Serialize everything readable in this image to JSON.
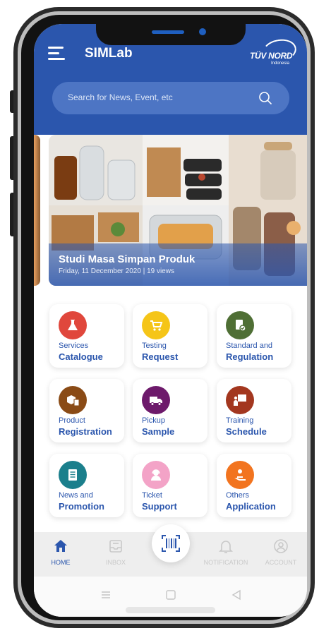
{
  "header": {
    "app_title": "SIMLab",
    "brand": {
      "name": "TÜV NORD",
      "sub": "Indonesia"
    }
  },
  "search": {
    "placeholder": "Search for News, Event, etc"
  },
  "banner": {
    "title": "Studi Masa Simpan Produk",
    "meta": "Friday, 11 December 2020 | 19 views"
  },
  "menu": [
    {
      "line1": "Services",
      "line2": "Catalogue",
      "icon": "flask-icon",
      "color": "#e0473c"
    },
    {
      "line1": "Testing",
      "line2": "Request",
      "icon": "cart-icon",
      "color": "#f5c518"
    },
    {
      "line1": "Standard and",
      "line2": "Regulation",
      "icon": "document-check-icon",
      "color": "#4f6f35"
    },
    {
      "line1": "Product",
      "line2": "Registration",
      "icon": "boxes-icon",
      "color": "#8a4b16"
    },
    {
      "line1": "Pickup",
      "line2": "Sample",
      "icon": "truck-icon",
      "color": "#6d1a6b"
    },
    {
      "line1": "Training",
      "line2": "Schedule",
      "icon": "presentation-icon",
      "color": "#a3371f"
    },
    {
      "line1": "News and",
      "line2": "Promotion",
      "icon": "newspaper-icon",
      "color": "#1b7f8c"
    },
    {
      "line1": "Ticket",
      "line2": "Support",
      "icon": "support-agent-icon",
      "color": "#f3a3c7"
    },
    {
      "line1": "Others",
      "line2": "Application",
      "icon": "hand-user-icon",
      "color": "#f2741f"
    }
  ],
  "bottom_nav": [
    {
      "label": "HOME",
      "icon": "home-icon",
      "active": true
    },
    {
      "label": "INBOX",
      "icon": "inbox-icon",
      "active": false
    },
    {
      "label": "NOTIFICATION",
      "icon": "bell-icon",
      "active": false
    },
    {
      "label": "ACCOUNT",
      "icon": "user-icon",
      "active": false
    }
  ],
  "colors": {
    "primary": "#2b56ad",
    "search_bg": "#4d75c4",
    "nav_inactive": "#c9c9c9"
  }
}
